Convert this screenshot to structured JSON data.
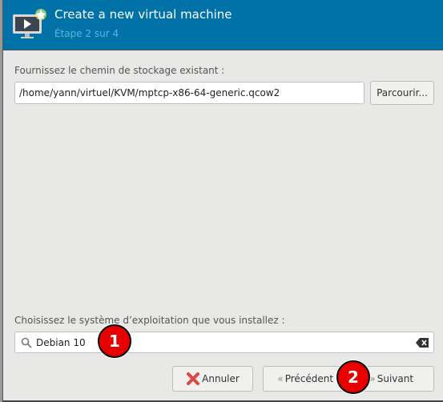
{
  "header": {
    "title": "Create a new virtual machine",
    "subtitle": "Étape 2 sur 4"
  },
  "storage": {
    "label": "Fournissez le chemin de stockage existant :",
    "path": "/home/yann/virtuel/KVM/mptcp-x86-64-generic.qcow2",
    "browse_label": "Parcourir..."
  },
  "os": {
    "label": "Choisissez le système d’exploitation que vous installez :",
    "value": "Debian 10"
  },
  "buttons": {
    "cancel": "Annuler",
    "back": "Précédent",
    "next": "Suivant"
  },
  "annotations": [
    "1",
    "2"
  ],
  "colors": {
    "header": "#0072a7",
    "badge": "#e60000"
  }
}
